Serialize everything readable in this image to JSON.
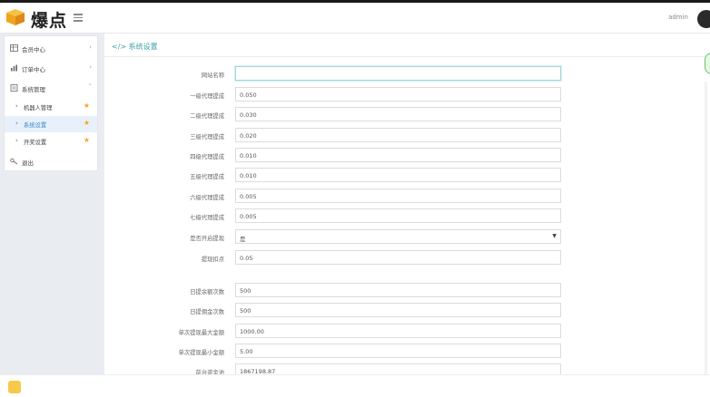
{
  "header": {
    "logo_text": "爆点",
    "user_label": "admin"
  },
  "sidebar": {
    "items": [
      {
        "label": "会员中心",
        "icon": "table-icon",
        "arrow": "›"
      },
      {
        "label": "订单中心",
        "icon": "bar-chart-icon",
        "arrow": "›"
      },
      {
        "label": "系统管理",
        "icon": "document-icon",
        "arrow": "˅"
      }
    ],
    "sub_items": [
      {
        "label": "机器人管理"
      },
      {
        "label": "系统设置"
      },
      {
        "label": "开奖设置"
      }
    ],
    "logout_label": "退出"
  },
  "panel": {
    "title_icon": "</>",
    "title": "系统设置"
  },
  "form": {
    "fields": [
      {
        "label": "网站名称",
        "value": ""
      },
      {
        "label": "一级代理提成",
        "value": "0.050"
      },
      {
        "label": "二级代理提成",
        "value": "0.030"
      },
      {
        "label": "三级代理提成",
        "value": "0.020"
      },
      {
        "label": "四级代理提成",
        "value": "0.010"
      },
      {
        "label": "五级代理提成",
        "value": "0.010"
      },
      {
        "label": "六级代理提成",
        "value": "0.005"
      },
      {
        "label": "七级代理提成",
        "value": "0.005"
      },
      {
        "label": "是否开启提现",
        "value": "是"
      },
      {
        "label": "提现扣点",
        "value": "0.05"
      },
      {
        "label": "日提余额次数",
        "value": "500"
      },
      {
        "label": "日提佣金次数",
        "value": "500"
      },
      {
        "label": "单次提现最大金额",
        "value": "1000.00"
      },
      {
        "label": "单次提现最小金额",
        "value": "5.00"
      },
      {
        "label": "前台资金池",
        "value": "1867198.87"
      }
    ]
  },
  "colors": {
    "accent": "#3ba0a8",
    "star": "#f5a623",
    "sidebar_bg": "#e9edf2"
  }
}
